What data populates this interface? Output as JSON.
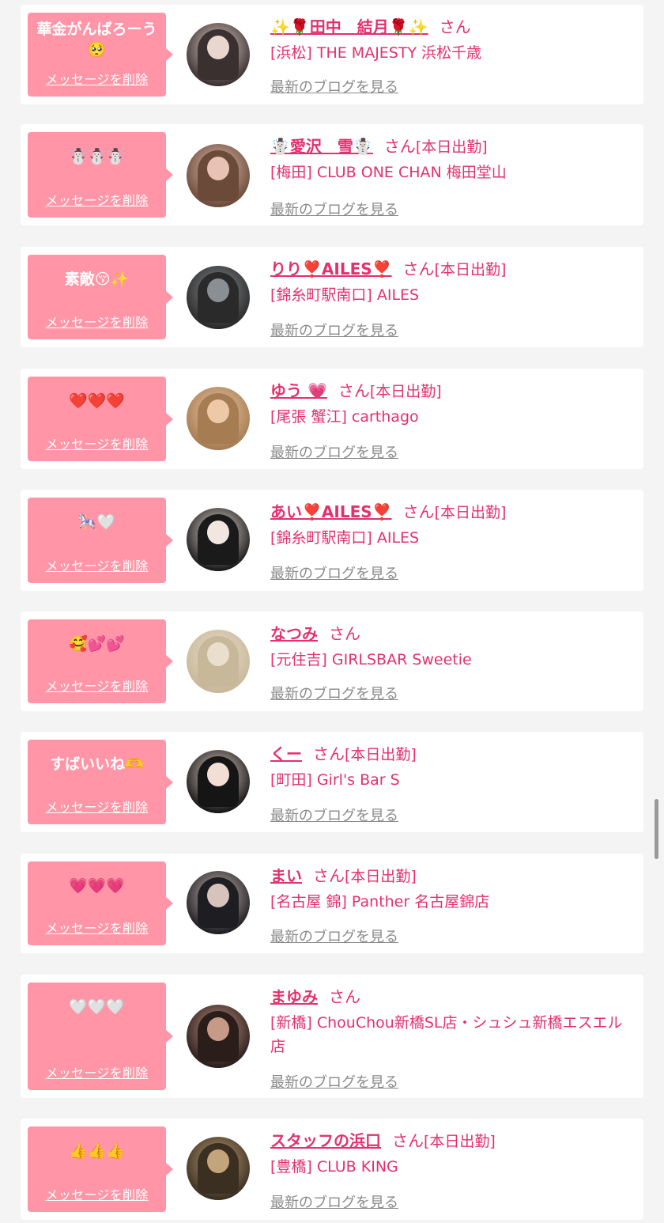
{
  "colors": {
    "accent": "#e4306d",
    "bubble": "#ff95a6",
    "link_gray": "#8a8a8a",
    "background": "#f4f4f4"
  },
  "delete_label": "メッセージを削除",
  "blog_label": "最新のブログを見る",
  "san_label": "さん",
  "entries": [
    {
      "message": "華金がんばろーう\n🥺",
      "name": "✨🌹田中　結月🌹✨",
      "shift": "",
      "shop": "[浜松] THE MAJESTY 浜松千歳"
    },
    {
      "message": "☃️☃️☃️",
      "name": "☃️愛沢＿雪☃️",
      "shift": "[本日出勤]",
      "shop": "[梅田] CLUB ONE CHAN 梅田堂山"
    },
    {
      "message": "素敵😚✨",
      "name": "りり❣️AILES❣️",
      "shift": "[本日出勤]",
      "shop": "[錦糸町駅南口] AILES"
    },
    {
      "message": "❤️❤️❤️",
      "name": "ゆう 💗",
      "shift": "[本日出勤]",
      "shop": "[尾張 蟹江] carthago"
    },
    {
      "message": "🎠🤍",
      "name": "あい❣️AILES❣️",
      "shift": "[本日出勤]",
      "shop": "[錦糸町駅南口] AILES"
    },
    {
      "message": "🥰💕💕",
      "name": "なつみ",
      "shift": "",
      "shop": "[元住吉] GIRLSBAR Sweetie"
    },
    {
      "message": "すばいいね🫶",
      "name": "くー",
      "shift": "[本日出勤]",
      "shop": "[町田] Girl's Bar S"
    },
    {
      "message": "💗💗💗",
      "name": "まい",
      "shift": "[本日出勤]",
      "shop": "[名古屋 錦] Panther 名古屋錦店"
    },
    {
      "message": "🤍🤍🤍",
      "name": "まゆみ",
      "shift": "",
      "shop": "[新橋] ChouChou新橋SL店・シュシュ新橋エスエル店"
    },
    {
      "message": "👍👍👍",
      "name": "スタッフの浜口",
      "shift": "[本日出勤]",
      "shop": "[豊橋] CLUB KING"
    }
  ]
}
